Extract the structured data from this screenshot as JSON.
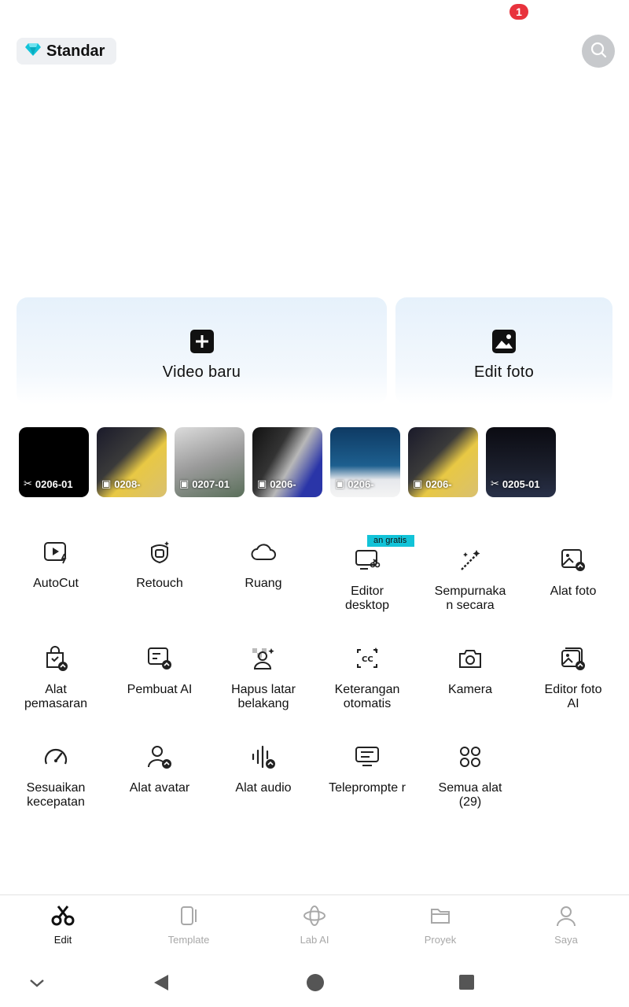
{
  "notification": {
    "count": "1"
  },
  "header": {
    "plan_label": "Standar"
  },
  "cards": {
    "new_video": "Video baru",
    "edit_photo": "Edit foto"
  },
  "recent": [
    {
      "label": "0206-01",
      "type": "video"
    },
    {
      "label": "0208-",
      "type": "image"
    },
    {
      "label": "0207-01",
      "type": "image"
    },
    {
      "label": "0206-",
      "type": "image"
    },
    {
      "label": "0206-",
      "type": "image"
    },
    {
      "label": "0206-",
      "type": "image"
    },
    {
      "label": "0205-01",
      "type": "video"
    }
  ],
  "tools": {
    "autocut": "AutoCut",
    "retouch": "Retouch",
    "ruang": "Ruang",
    "editor_desktop": "Editor desktop",
    "editor_desktop_badge": "an gratis",
    "sempurnakan": "Sempurnaka n secara",
    "alat_foto": "Alat foto",
    "alat_pemasaran": "Alat pemasaran",
    "pembuat_ai": "Pembuat AI",
    "hapus_latar": "Hapus latar belakang",
    "keterangan": "Keterangan otomatis",
    "kamera": "Kamera",
    "editor_foto_ai": "Editor foto AI",
    "sesuaikan": "Sesuaikan kecepatan",
    "alat_avatar": "Alat avatar",
    "alat_audio": "Alat audio",
    "teleprompter": "Teleprompte r",
    "semua_alat": "Semua alat (29)"
  },
  "nav": {
    "edit": "Edit",
    "template": "Template",
    "lab_ai": "Lab AI",
    "proyek": "Proyek",
    "saya": "Saya"
  },
  "colors": {
    "accent_teal": "#12c3d8",
    "badge_red": "#e8323c",
    "inactive_gray": "#a8a8a8"
  }
}
